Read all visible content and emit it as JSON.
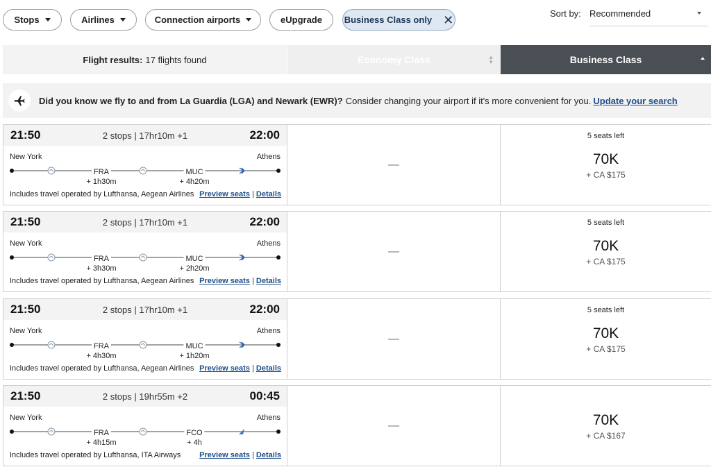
{
  "filters": {
    "stops": "Stops",
    "airlines": "Airlines",
    "connection_airports": "Connection airports",
    "eupgrade": "eUpgrade",
    "business_only": "Business Class only"
  },
  "sort": {
    "label": "Sort by:",
    "value": "Recommended"
  },
  "header": {
    "results_label": "Flight results:",
    "results_count": "17 flights found",
    "economy": "Economy Class",
    "business": "Business Class"
  },
  "notice": {
    "bold": "Did you know we fly to and from La Guardia (LGA) and Newark (EWR)?",
    "text": "Consider changing your airport if it's more convenient for you.",
    "link": "Update your search"
  },
  "flights": [
    {
      "depart": "21:50",
      "arrive": "22:00",
      "summary": "2 stops | 17hr10m +1",
      "origin": "New York",
      "destination": "Athens",
      "stop1": "FRA",
      "layover1": "+ 1h30m",
      "stop2": "MUC",
      "layover2": "+ 4h20m",
      "operated": "Includes travel operated by Lufthansa, Aegean Airlines",
      "preview": "Preview seats",
      "details": "Details",
      "economy": "—",
      "seats": "5 seats left",
      "price": "70K",
      "fee": "+ CA $175"
    },
    {
      "depart": "21:50",
      "arrive": "22:00",
      "summary": "2 stops | 17hr10m +1",
      "origin": "New York",
      "destination": "Athens",
      "stop1": "FRA",
      "layover1": "+ 3h30m",
      "stop2": "MUC",
      "layover2": "+ 2h20m",
      "operated": "Includes travel operated by Lufthansa, Aegean Airlines",
      "preview": "Preview seats",
      "details": "Details",
      "economy": "—",
      "seats": "5 seats left",
      "price": "70K",
      "fee": "+ CA $175"
    },
    {
      "depart": "21:50",
      "arrive": "22:00",
      "summary": "2 stops | 17hr10m +1",
      "origin": "New York",
      "destination": "Athens",
      "stop1": "FRA",
      "layover1": "+ 4h30m",
      "stop2": "MUC",
      "layover2": "+ 1h20m",
      "operated": "Includes travel operated by Lufthansa, Aegean Airlines",
      "preview": "Preview seats",
      "details": "Details",
      "economy": "—",
      "seats": "5 seats left",
      "price": "70K",
      "fee": "+ CA $175"
    },
    {
      "depart": "21:50",
      "arrive": "00:45",
      "summary": "2 stops | 19hr55m +2",
      "origin": "New York",
      "destination": "Athens",
      "stop1": "FRA",
      "layover1": "+ 4h15m",
      "stop2": "FCO",
      "layover2": "+ 4h",
      "operated": "Includes travel operated by Lufthansa, ITA Airways",
      "preview": "Preview seats",
      "details": "Details",
      "economy": "—",
      "seats": "",
      "price": "70K",
      "fee": "+ CA $167"
    }
  ],
  "icons": {
    "notice": "plane-icon",
    "lufthansa": "lufthansa-logo-icon",
    "aegean": "aegean-logo-icon",
    "ita": "ita-logo-icon"
  },
  "colors": {
    "business_header": "#4a4f55",
    "link": "#1d4e89",
    "active_filter": "#dfe8f2"
  }
}
